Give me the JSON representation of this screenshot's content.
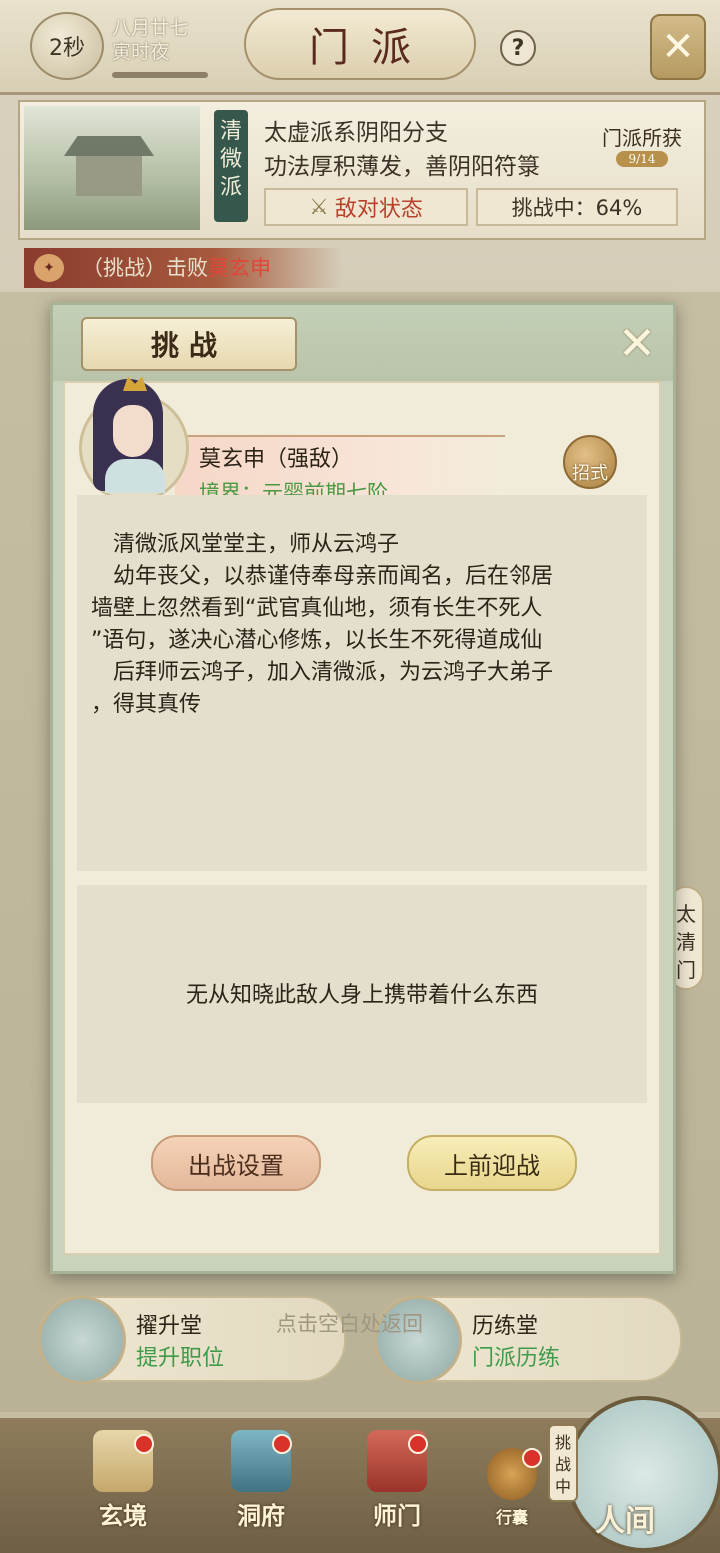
{
  "header": {
    "timer": "2秒",
    "date_line1": "八月廿七",
    "date_line2": "寅时夜",
    "title": "门派",
    "help_icon": "?",
    "close_icon": "✕"
  },
  "sect": {
    "banner": "清微派",
    "desc_line1": "太虚派系阴阳分支",
    "desc_line2": "功法厚积薄发，善阴阳符箓",
    "status_label": "敌对状态",
    "challenge_label": "挑战中：64%",
    "gains_label": "门派所获",
    "gains_count": "9/14"
  },
  "notice": {
    "prefix": "（挑战）击败",
    "enemy": "莫玄申"
  },
  "side_tag": "太清门",
  "modal": {
    "title": "挑战",
    "close_icon": "✕",
    "enemy_name": "莫玄申（强敌）",
    "enemy_realm": "境界：元婴前期七阶",
    "skill_button": "招式",
    "description": [
      {
        "text": "清微派风堂堂主，师从云鸿子",
        "indent": true
      },
      {
        "text": "幼年丧父，以恭谨侍奉母亲而闻名，后在邻居",
        "indent": true
      },
      {
        "text": "墙壁上忽然看到“武官真仙地，须有长生不死人",
        "indent": false
      },
      {
        "text": "”语句，遂决心潜心修炼，以长生不死得道成仙",
        "indent": false
      },
      {
        "text": "后拜师云鸿子，加入清微派，为云鸿子大弟子",
        "indent": true
      },
      {
        "text": "，得其真传",
        "indent": false
      }
    ],
    "loot_text": "无从知晓此敌人身上携带着什么东西",
    "setup_button": "出战设置",
    "fight_button": "上前迎战"
  },
  "halls": [
    {
      "name": "擢升堂",
      "sub": "提升职位"
    },
    {
      "name": "历练堂",
      "sub": "门派历练"
    }
  ],
  "hint": "点击空白处返回",
  "nav": [
    {
      "label": "玄境",
      "dot": true
    },
    {
      "label": "洞府",
      "dot": true
    },
    {
      "label": "师门",
      "dot": true
    },
    {
      "label": "行囊",
      "dot": true
    }
  ],
  "world": {
    "label": "人间",
    "tag": "挑战中"
  },
  "colors": {
    "enemy_red": "#e0463a",
    "realm_green": "#4a9a43",
    "status_red": "#b8412c"
  }
}
